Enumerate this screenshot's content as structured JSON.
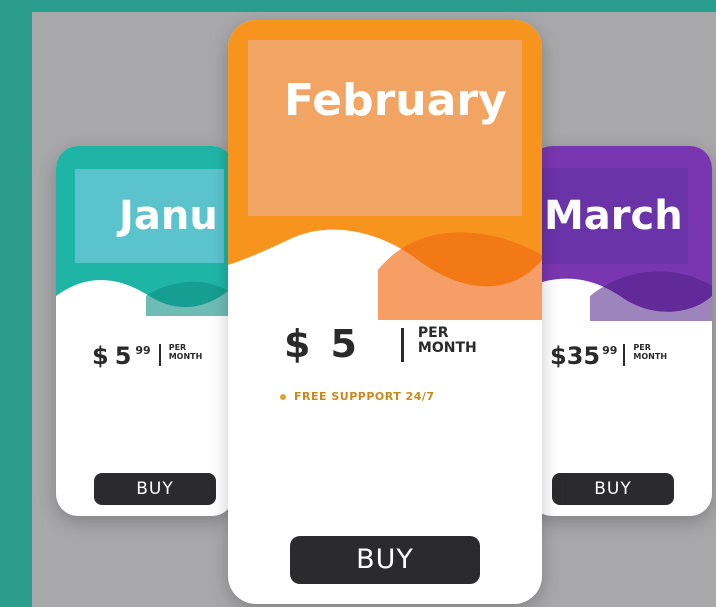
{
  "colors": {
    "frame": "#2a9d8f",
    "background": "#a8a8ab",
    "january": "#1fb5a6",
    "january_box": "#5bc3cc",
    "february": "#f6941e",
    "february_box": "#f2a463",
    "march": "#7a36b0",
    "march_box": "#6b33a8",
    "button": "#2b2b2d"
  },
  "cards": {
    "january": {
      "month": "Janu",
      "currency": "$",
      "price": "5",
      "cents": "99",
      "per_line1": "PER",
      "per_line2": "MONTH",
      "buy_label": "BUY"
    },
    "february": {
      "month": "February",
      "currency": "$",
      "price": "5",
      "per_line1": "PER",
      "per_line2": "MONTH",
      "feature": "FREE SUPPPORT 24/7",
      "buy_label": "BUY"
    },
    "march": {
      "month": "March",
      "currency": "$",
      "price": "35",
      "cents": "99",
      "per_line1": "PER",
      "per_line2": "MONTH",
      "buy_label": "BUY"
    }
  }
}
